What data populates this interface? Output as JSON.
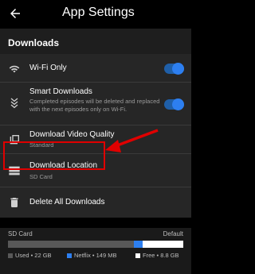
{
  "app_bar": {
    "title": "App Settings"
  },
  "section": {
    "title": "Downloads"
  },
  "rows": [
    {
      "title": "Wi-Fi Only",
      "subtitle": "",
      "icon": "wifi-icon",
      "toggle": true
    },
    {
      "title": "Smart Downloads",
      "subtitle": "Completed episodes will be deleted and replaced with the next episodes only on Wi-Fi.",
      "icon": "smart-downloads-icon",
      "toggle": true
    },
    {
      "title": "Download Video Quality",
      "subtitle": "Standard",
      "icon": "video-quality-icon"
    },
    {
      "title": "Download Location",
      "subtitle": "SD Card",
      "icon": "storage-icon"
    },
    {
      "title": "Delete All Downloads",
      "subtitle": "",
      "icon": "trash-icon"
    }
  ],
  "storage": {
    "label": "SD Card",
    "default_label": "Default",
    "used": {
      "label": "Used • 22 GB",
      "fraction": 0.72,
      "color": "#585858"
    },
    "netflix": {
      "label": "Netflix • 149 MB",
      "fraction": 0.05,
      "color": "#2d7ff0"
    },
    "free": {
      "label": "Free • 8.8 GB",
      "fraction": 0.23,
      "color": "#ffffff"
    }
  },
  "colors": {
    "accent": "#2d7ff0",
    "highlight": "#e00000"
  }
}
